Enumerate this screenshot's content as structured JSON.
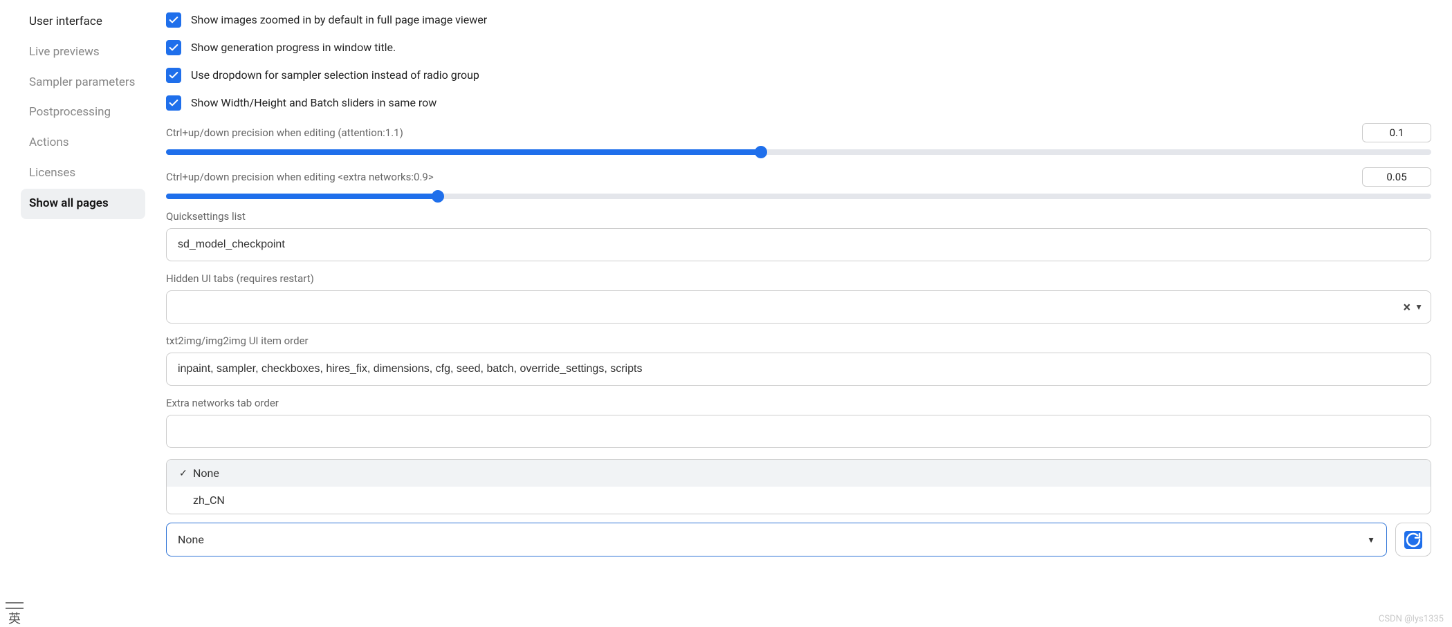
{
  "sidebar": {
    "items": [
      {
        "label": "User interface",
        "dark": true,
        "selected": false
      },
      {
        "label": "Live previews",
        "dark": false,
        "selected": false
      },
      {
        "label": "Sampler parameters",
        "dark": false,
        "selected": false
      },
      {
        "label": "Postprocessing",
        "dark": false,
        "selected": false
      },
      {
        "label": "Actions",
        "dark": false,
        "selected": false
      },
      {
        "label": "Licenses",
        "dark": false,
        "selected": false
      },
      {
        "label": "Show all pages",
        "dark": true,
        "selected": true
      }
    ]
  },
  "checks": {
    "zoom_label": "Show images zoomed in by default in full page image viewer",
    "progress_label": "Show generation progress in window title.",
    "dropdown_label": "Use dropdown for sampler selection instead of radio group",
    "samerow_label": "Show Width/Height and Batch sliders in same row"
  },
  "sliders": {
    "precision_attn": {
      "label": "Ctrl+up/down precision when editing (attention:1.1)",
      "value": "0.1",
      "fill_pct": 47
    },
    "precision_extra": {
      "label": "Ctrl+up/down precision when editing <extra networks:0.9>",
      "value": "0.05",
      "fill_pct": 21.5
    }
  },
  "fields": {
    "quicksettings": {
      "label": "Quicksettings list",
      "value": "sd_model_checkpoint"
    },
    "hidden_tabs": {
      "label": "Hidden UI tabs (requires restart)",
      "value": ""
    },
    "item_order": {
      "label": "txt2img/img2img UI item order",
      "value": "inpaint, sampler, checkboxes, hires_fix, dimensions, cfg, seed, batch, override_settings, scripts"
    },
    "extra_order": {
      "label": "Extra networks tab order",
      "value": ""
    }
  },
  "locale_select": {
    "options": [
      {
        "label": "None",
        "selected": true
      },
      {
        "label": "zh_CN",
        "selected": false
      }
    ],
    "value": "None"
  },
  "ime": {
    "label": "英"
  },
  "watermark": "CSDN @lys1335"
}
